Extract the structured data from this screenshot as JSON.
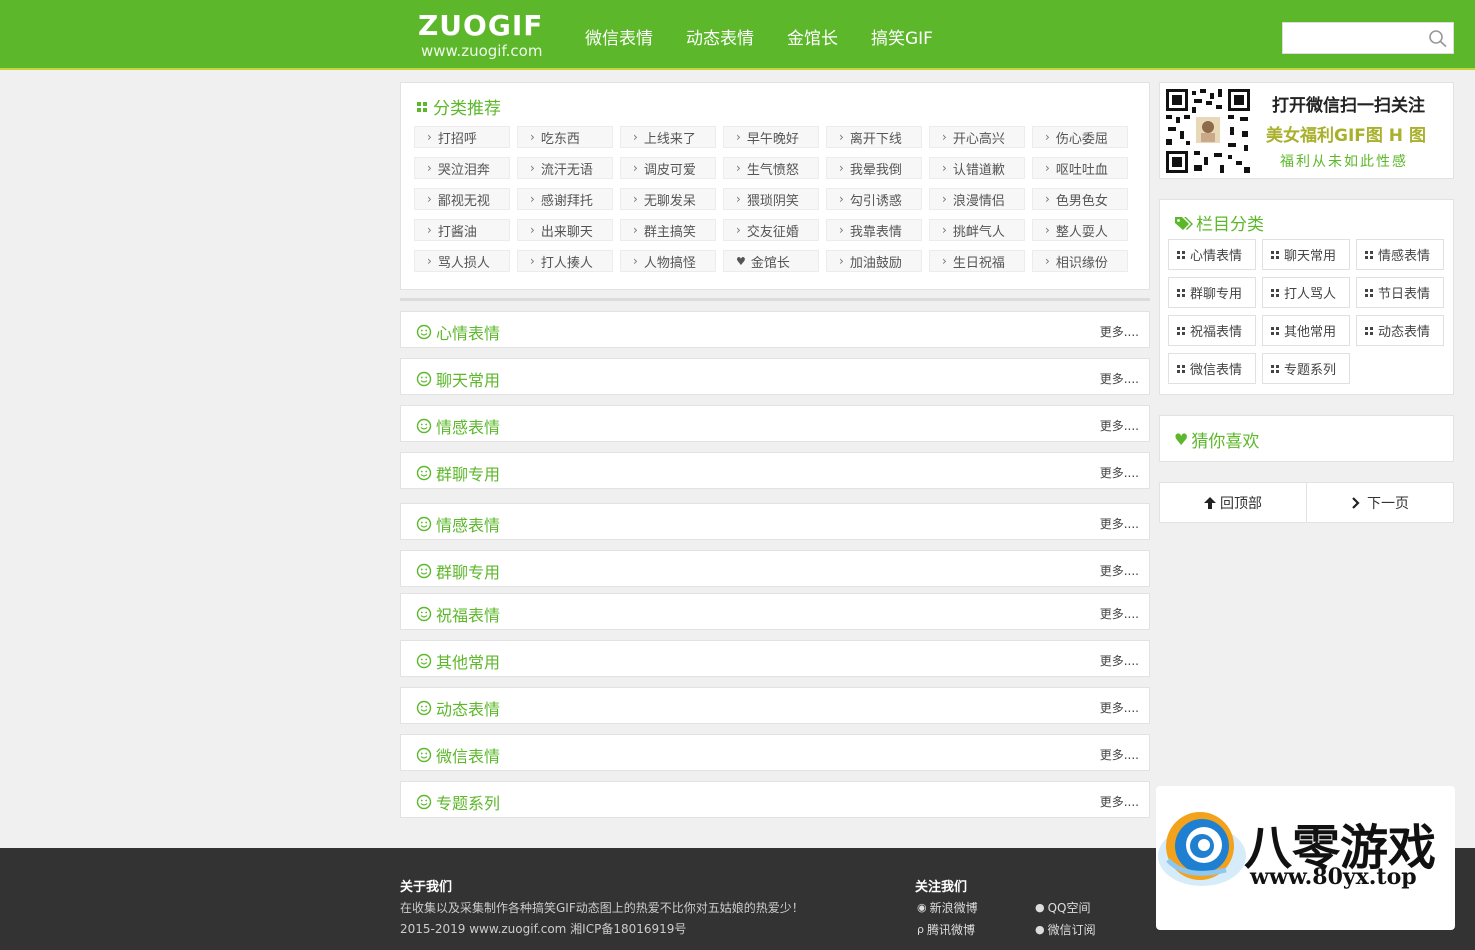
{
  "header": {
    "logo_main": "ZUOGIF",
    "logo_sub": "www.zuogif.com",
    "nav": [
      "微信表情",
      "动态表情",
      "金馆长",
      "搞笑GIF"
    ],
    "search_placeholder": ""
  },
  "categories": {
    "title": "分类推荐",
    "tags": [
      "打招呼",
      "吃东西",
      "上线来了",
      "早午晚好",
      "离开下线",
      "开心高兴",
      "伤心委屈",
      "哭泣泪奔",
      "流汗无语",
      "调皮可爱",
      "生气愤怒",
      "我晕我倒",
      "认错道歉",
      "呕吐吐血",
      "鄙视无视",
      "感谢拜托",
      "无聊发呆",
      "猥琐阴笑",
      "勾引诱惑",
      "浪漫情侣",
      "色男色女",
      "打酱油",
      "出来聊天",
      "群主搞笑",
      "交友征婚",
      "我靠表情",
      "挑衅气人",
      "整人耍人",
      "骂人损人",
      "打人揍人",
      "人物搞怪",
      "金馆长",
      "加油鼓励",
      "生日祝福",
      "相识缘份"
    ]
  },
  "sections": {
    "more_label": "更多....",
    "items": [
      "心情表情",
      "聊天常用",
      "情感表情",
      "群聊专用",
      "情感表情",
      "群聊专用",
      "祝福表情",
      "其他常用",
      "动态表情",
      "微信表情",
      "专题系列"
    ]
  },
  "sidebar": {
    "qr_line1": "打开微信扫一扫关注",
    "qr_line2": "美女福利GIF图 H 图",
    "qr_line3": "福利从未如此性感",
    "columns_title": "栏目分类",
    "columns": [
      "心情表情",
      "聊天常用",
      "情感表情",
      "群聊专用",
      "打人骂人",
      "节日表情",
      "祝福表情",
      "其他常用",
      "动态表情",
      "微信表情",
      "专题系列"
    ],
    "guess_title": "猜你喜欢",
    "back_top": "回顶部",
    "next_page": "下一页"
  },
  "footer": {
    "about_title": "关于我们",
    "about_desc": "在收集以及采集制作各种搞笑GIF动态图上的热爱不比你对五姑娘的热爱少！",
    "copyright": "2015-2019 www.zuogif.com 湘ICP备18016919号",
    "follow_title": "关注我们",
    "links": [
      "新浪微博",
      "QQ空间",
      "腾讯微博",
      "微信订阅"
    ]
  },
  "watermark": {
    "text": "八零游戏",
    "url": "www.80yx.top"
  },
  "colors": {
    "brand_green": "#5cb82a",
    "footer_bg": "#333333",
    "page_bg": "#f0f0f0"
  }
}
